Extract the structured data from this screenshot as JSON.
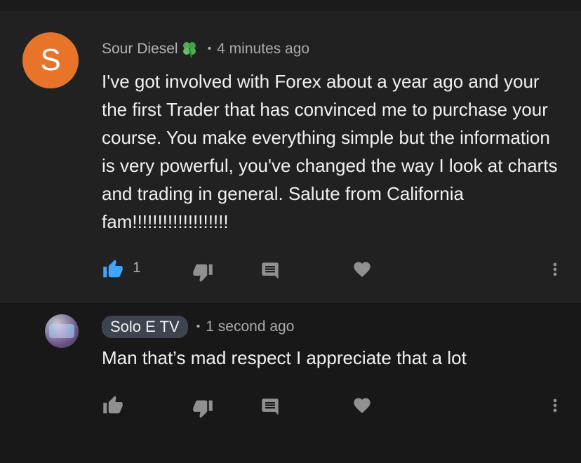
{
  "comments": [
    {
      "author": "Sour Diesel",
      "avatar_letter": "S",
      "avatar_color": "#e8742a",
      "time": "4 minutes ago",
      "text": "I've got involved with Forex about a year ago and your the first Trader that has convinced me to purchase your course. You make everything simple but the information is very powerful, you've changed the way I look at charts and trading in general. Salute from California fam!!!!!!!!!!!!!!!!!!!",
      "likes": "1",
      "liked": true
    },
    {
      "author": "Solo E TV",
      "time": "1 second ago",
      "text": "Man that’s mad respect I appreciate that a lot",
      "likes": "",
      "liked": false
    }
  ],
  "icons": [
    "thumb-up-icon",
    "thumb-down-icon",
    "reply-icon",
    "heart-icon",
    "more-vert-icon",
    "clover-icon"
  ],
  "colors": {
    "like_active": "#3ea6ff",
    "icon_gray": "#909090"
  }
}
